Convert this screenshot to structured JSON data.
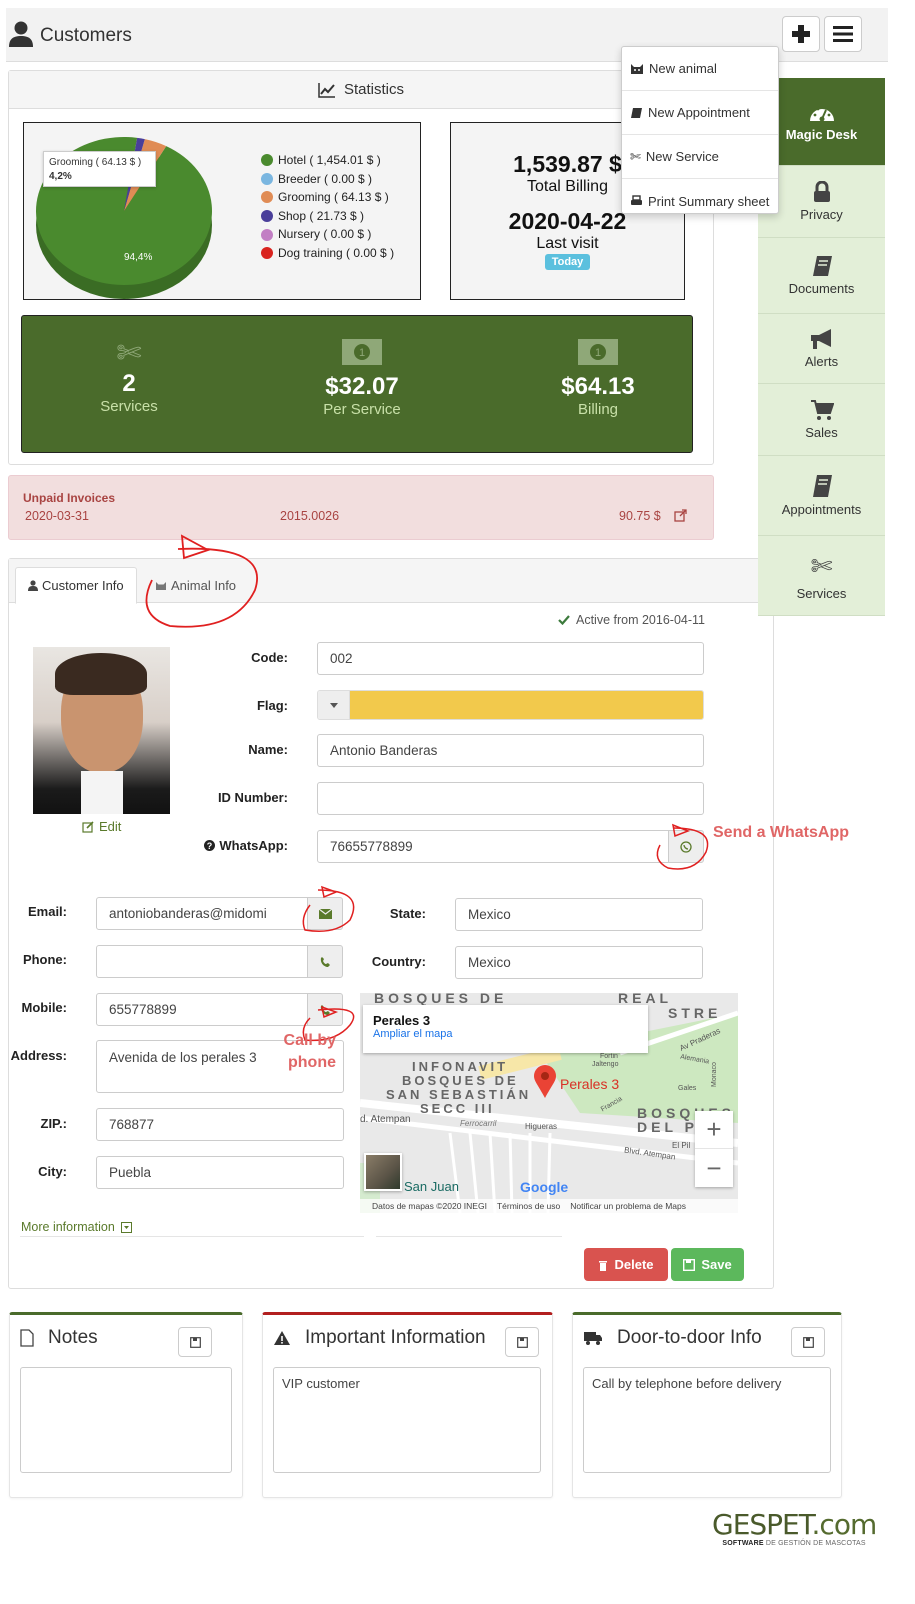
{
  "header": {
    "title": "Customers",
    "add_button_icon": "plus-icon",
    "menu_button_icon": "hamburger-icon"
  },
  "dropdown_menu": [
    {
      "icon": "cat-icon",
      "label": "New animal"
    },
    {
      "icon": "book-icon",
      "label": "New Appointment"
    },
    {
      "icon": "scissors-icon",
      "label": "New Service"
    },
    {
      "icon": "print-icon",
      "label": "Print Summary sheet"
    }
  ],
  "sidebar": [
    {
      "icon": "dashboard-icon",
      "label": "Magic Desk",
      "active": true
    },
    {
      "icon": "lock-icon",
      "label": "Privacy"
    },
    {
      "icon": "book-icon",
      "label": "Documents"
    },
    {
      "icon": "megaphone-icon",
      "label": "Alerts"
    },
    {
      "icon": "cart-icon",
      "label": "Sales"
    },
    {
      "icon": "book-icon",
      "label": "Appointments"
    },
    {
      "icon": "scissors-icon",
      "label": "Services"
    }
  ],
  "statistics": {
    "title": "Statistics",
    "tooltip": {
      "label": "Grooming ( 64.13 $ )",
      "value": "4,2%"
    },
    "pie_main_label": "94,4%",
    "total_billing": "1,539.87 $",
    "total_billing_label": "Total Billing",
    "last_visit": "2020-04-22",
    "last_visit_label": "Last visit",
    "last_visit_badge": "Today",
    "summary": [
      {
        "icon": "scissors-icon",
        "value": "2",
        "label": "Services"
      },
      {
        "icon": "money-icon",
        "value": "$32.07",
        "label": "Per Service"
      },
      {
        "icon": "money-icon",
        "value": "$64.13",
        "label": "Billing"
      }
    ]
  },
  "chart_data": {
    "type": "pie",
    "title": "",
    "legend_position": "right",
    "categories": [
      "Hotel",
      "Breeder",
      "Grooming",
      "Shop",
      "Nursery",
      "Dog training"
    ],
    "values": [
      1454.01,
      0.0,
      64.13,
      21.73,
      0.0,
      0.0
    ],
    "legend_labels": [
      "Hotel ( 1,454.01 $ )",
      "Breeder ( 0.00 $ )",
      "Grooming ( 64.13 $ )",
      "Shop ( 21.73 $ )",
      "Nursery ( 0.00 $ )",
      "Dog training ( 0.00 $ )"
    ],
    "colors": [
      "#4a8a2e",
      "#7ab6e0",
      "#e08c55",
      "#4a3f9a",
      "#c27fc4",
      "#d9241f"
    ],
    "data_labels": {
      "Hotel": "94,4%",
      "Grooming": "4,2%"
    }
  },
  "unpaid_invoices": {
    "title": "Unpaid Invoices",
    "rows": [
      {
        "date": "2020-03-31",
        "number": "2015.0026",
        "amount": "90.75 $"
      }
    ]
  },
  "tabs": [
    {
      "icon": "user-icon",
      "label": "Customer Info",
      "active": true
    },
    {
      "icon": "cat-icon",
      "label": "Animal Info"
    }
  ],
  "customer": {
    "active_from": "Active from 2016-04-11",
    "photo_edit": "Edit",
    "fields": {
      "code": {
        "label": "Code:",
        "value": "002"
      },
      "flag": {
        "label": "Flag:",
        "color": "#f2c94c"
      },
      "name": {
        "label": "Name:",
        "value": "Antonio Banderas"
      },
      "id_number": {
        "label": "ID Number:",
        "value": ""
      },
      "whatsapp": {
        "label": "WhatsApp:",
        "value": "76655778899"
      },
      "email": {
        "label": "Email:",
        "value": "antoniobanderas@midomi"
      },
      "phone": {
        "label": "Phone:",
        "value": ""
      },
      "mobile": {
        "label": "Mobile:",
        "value": "655778899"
      },
      "address": {
        "label": "Address:",
        "value": "Avenida de los perales 3"
      },
      "zip": {
        "label": "ZIP.:",
        "value": "768877"
      },
      "city": {
        "label": "City:",
        "value": "Puebla"
      },
      "state": {
        "label": "State:",
        "value": "Mexico"
      },
      "country": {
        "label": "Country:",
        "value": "Mexico"
      }
    },
    "more_info": "More information",
    "delete_label": "Delete",
    "save_label": "Save"
  },
  "map": {
    "place_title": "Perales 3",
    "enlarge_link": "Ampliar el mapa",
    "marker_label": "Perales 3",
    "area_labels": [
      "BOSQUES DE",
      "REAL",
      "STRE",
      "INFONAVIT",
      "BOSQUES DE",
      "SAN SEBASTIÁN",
      "SECC III",
      "BOSQUES",
      "DEL PI"
    ],
    "streets": [
      "d. Atempan",
      "Ferrocarril",
      "Higueras",
      "Blvd. Atempan",
      "Av Praderas",
      "Alemania",
      "Gales",
      "Francia",
      "Jaltengo",
      "Fortin",
      "El Pil",
      "Monaco"
    ],
    "place_bottom": "San Juan",
    "logo": "Google",
    "footer": [
      "Datos de mapas ©2020 INEGI",
      "Términos de uso",
      "Notificar un problema de Maps"
    ],
    "zoom_in": "+",
    "zoom_out": "−"
  },
  "annotations": {
    "whatsapp": "Send a WhatsApp",
    "phone_line1": "Call by",
    "phone_line2": "phone"
  },
  "notes": [
    {
      "icon": "file-icon",
      "title": "Notes",
      "content": "",
      "accent": "#4a6b2b"
    },
    {
      "icon": "warning-icon",
      "title": "Important Information",
      "content": "VIP customer",
      "accent": "#b21f1f"
    },
    {
      "icon": "truck-icon",
      "title": "Door-to-door Info",
      "content": "Call by telephone before delivery",
      "accent": "#4a6b2b"
    }
  ],
  "brand": {
    "name_main": "GESPET",
    "name_tld": ".com",
    "tagline_a": "SOFTWARE",
    "tagline_b": " DE GESTIÓN DE MASCOTAS"
  }
}
